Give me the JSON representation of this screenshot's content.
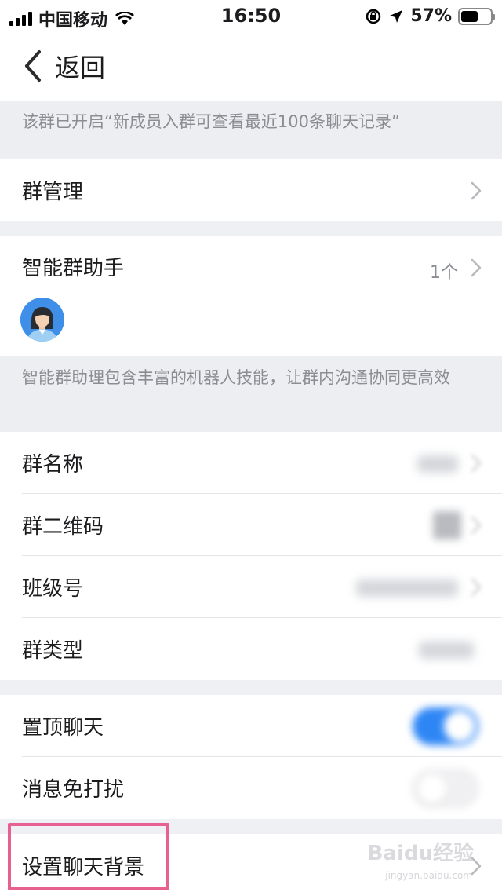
{
  "status_bar": {
    "carrier": "中国移动",
    "time": "16:50",
    "battery": "57%",
    "battery_level": 0.57
  },
  "nav": {
    "back_label": "返回"
  },
  "history_note": "该群已开启“新成员入群可查看最近100条聊天记录”",
  "group_manage": {
    "label": "群管理"
  },
  "assistant": {
    "label": "智能群助手",
    "count": "1个",
    "note": "智能群助理包含丰富的机器人技能，让群内沟通协同更高效"
  },
  "info_rows": [
    {
      "label": "群名称"
    },
    {
      "label": "群二维码"
    },
    {
      "label": "班级号"
    },
    {
      "label": "群类型"
    }
  ],
  "toggle_rows": [
    {
      "label": "置顶聊天",
      "on": true
    },
    {
      "label": "消息免打扰",
      "on": false
    }
  ],
  "background_row": {
    "label": "设置聊天背景"
  },
  "watermark": {
    "brand": "Baidu经验",
    "url": "jingyan.baidu.com"
  },
  "colors": {
    "accent": "#2e86f5",
    "highlight": "#e8608f"
  }
}
